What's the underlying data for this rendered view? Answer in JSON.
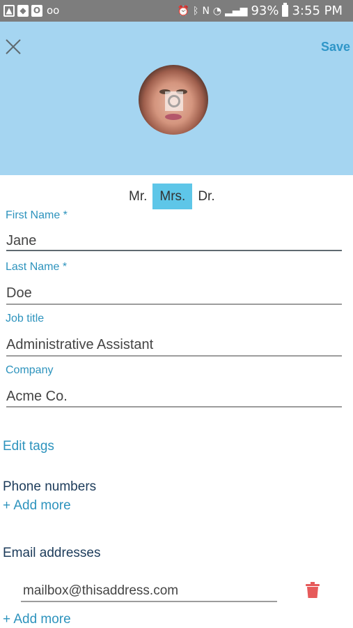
{
  "status_bar": {
    "battery": "93%",
    "time": "3:55 PM"
  },
  "header": {
    "save_label": "Save"
  },
  "salutations": [
    "Mr.",
    "Mrs.",
    "Dr."
  ],
  "fields": {
    "first_name": {
      "label": "First Name *",
      "value": "Jane"
    },
    "last_name": {
      "label": "Last Name *",
      "value": "Doe"
    },
    "job_title": {
      "label": "Job title",
      "value": "Administrative Assistant"
    },
    "company": {
      "label": "Company",
      "value": "Acme Co."
    }
  },
  "tags": {
    "edit_label": "Edit tags"
  },
  "phone": {
    "title": "Phone numbers",
    "add_label": "+ Add more"
  },
  "email": {
    "title": "Email addresses",
    "value": "mailbox@thisaddress.com",
    "add_label": "+ Add more"
  },
  "colors": {
    "header_bg": "#a5d5f1",
    "accent": "#2d93bd",
    "selected_salutation": "#5ec6e8",
    "trash": "#e65a5a"
  }
}
